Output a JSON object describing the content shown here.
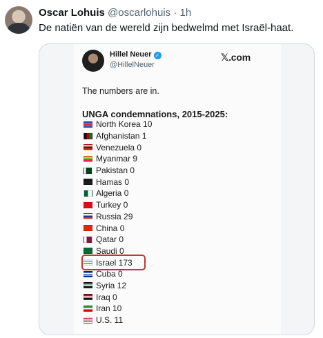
{
  "tweet": {
    "author_name": "Oscar Lohuis",
    "author_handle": "@oscarlohuis",
    "separator": "·",
    "time": "1h",
    "text": "De natiën van de wereld zijn bedwelmd met Israël-haat."
  },
  "embedded": {
    "author_name": "Hillel Neuer",
    "verified_icon": "verified-badge-icon",
    "author_handle": "@HillelNeuer",
    "source": "𝕏.com",
    "intro": "The numbers are in.",
    "title": "UNGA condemnations, 2015-2025:",
    "countries": [
      {
        "label": "North Korea 10",
        "flag": "north-korea-flag-icon"
      },
      {
        "label": "Afghanistan 1",
        "flag": "afghanistan-flag-icon"
      },
      {
        "label": "Venezuela 0",
        "flag": "venezuela-flag-icon"
      },
      {
        "label": "Myanmar 9",
        "flag": "myanmar-flag-icon"
      },
      {
        "label": "Pakistan 0",
        "flag": "pakistan-flag-icon"
      },
      {
        "label": "Hamas 0",
        "flag": "hamas-flag-icon"
      },
      {
        "label": "Algeria 0",
        "flag": "algeria-flag-icon"
      },
      {
        "label": "Turkey 0",
        "flag": "turkey-flag-icon"
      },
      {
        "label": "Russia 29",
        "flag": "russia-flag-icon"
      },
      {
        "label": "China 0",
        "flag": "china-flag-icon"
      },
      {
        "label": "Qatar 0",
        "flag": "qatar-flag-icon"
      },
      {
        "label": "Saudi 0",
        "flag": "saudi-flag-icon"
      },
      {
        "label": "Israel 173",
        "flag": "israel-flag-icon",
        "highlighted": true
      },
      {
        "label": "Cuba 0",
        "flag": "cuba-flag-icon"
      },
      {
        "label": "Syria 12",
        "flag": "syria-flag-icon"
      },
      {
        "label": "Iraq 0",
        "flag": "iraq-flag-icon"
      },
      {
        "label": "Iran 10",
        "flag": "iran-flag-icon"
      },
      {
        "label": "U.S. 11",
        "flag": "us-flag-icon"
      }
    ]
  },
  "colors": {
    "highlight_border": "#c0392b",
    "verified": "#1d9bf0",
    "secondary_text": "#536471"
  }
}
